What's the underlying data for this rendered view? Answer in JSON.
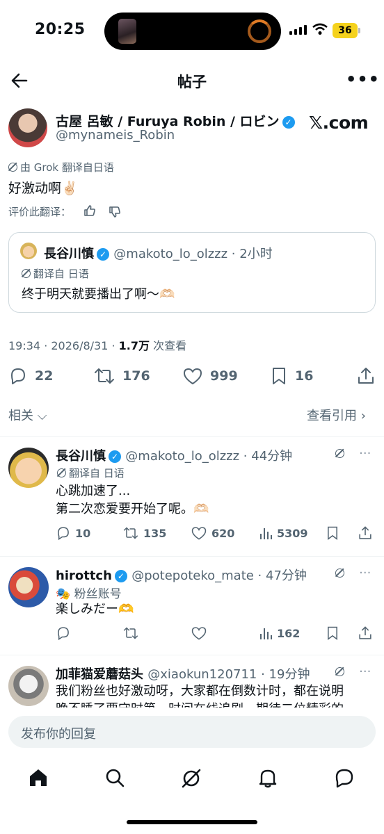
{
  "status_bar": {
    "time": "20:25",
    "battery": "36"
  },
  "header": {
    "title": "帖子",
    "more": "•••"
  },
  "post": {
    "author_name": "古屋 呂敏 / Furuya Robin / ロビン",
    "author_handle": "@mynameis_Robin",
    "watermark": "𝕏.com",
    "translation_note": "由 Grok 翻译自日语",
    "text": "好激动啊✌🏻",
    "rate_translation": "评价此翻译：",
    "quote": {
      "name": "長谷川慎",
      "handle_time": "@makoto_lo_olzzz · 2小时",
      "translation_note": "翻译自 日语",
      "text": "终于明天就要播出了啊～🫶🏻"
    },
    "meta_time": "19:34 · 2026/8/31 · ",
    "meta_views": "1.7万",
    "meta_views_label": " 次查看",
    "counts": {
      "replies": "22",
      "reposts": "176",
      "likes": "999",
      "bookmarks": "16"
    }
  },
  "related": {
    "label": "相关",
    "quotes_link": "查看引用"
  },
  "replies": [
    {
      "name": "長谷川慎",
      "handle_time": "@makoto_lo_olzzz · 44分钟",
      "sub": "翻译自 日语",
      "text_line1": "心跳加速了...",
      "text_line2": "第二次恋爱要开始了呢。🫶🏻",
      "replies": "10",
      "reposts": "135",
      "likes": "620",
      "views": "5309"
    },
    {
      "name": "hirottch",
      "handle_time": "@potepoteko_mate · 47分钟",
      "sub": "粉丝账号",
      "text_line1": "楽しみだー🫶",
      "views": "162"
    },
    {
      "name": "加菲猫爱蘑菇头",
      "handle_time": "@xiaokun120711 · 19分钟",
      "text_line1": "我们粉丝也好激动呀，大家都在倒数计时，都在说明",
      "text_line2": "晚不睡了要守时第一时间在线追剧，期待二位精彩的"
    }
  ],
  "compose": {
    "placeholder": "发布你的回复"
  },
  "colors": {
    "accent": "#1d9bf0",
    "text": "#0f1419",
    "secondary": "#536471",
    "battery": "#f5d21d"
  }
}
